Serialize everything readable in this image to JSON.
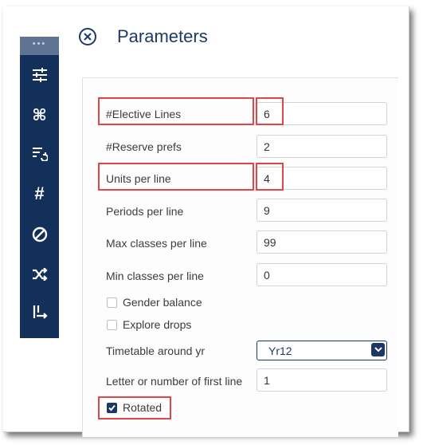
{
  "header": {
    "title": "Parameters",
    "close_icon": "close-circle-icon"
  },
  "sidebar": {
    "grip": "•••",
    "items": [
      {
        "icon": "sliders-icon"
      },
      {
        "icon": "command-icon"
      },
      {
        "icon": "list-refresh-icon"
      },
      {
        "icon": "hash-icon",
        "glyph": "#"
      },
      {
        "icon": "no-symbol-icon"
      },
      {
        "icon": "shuffle-icon"
      },
      {
        "icon": "sort-swap-icon"
      }
    ]
  },
  "form": {
    "elective_lines": {
      "label": "#Elective Lines",
      "value": "6"
    },
    "reserve_prefs": {
      "label": "#Reserve prefs",
      "value": "2"
    },
    "units_per_line": {
      "label": "Units per line",
      "value": "4"
    },
    "periods_per_line": {
      "label": "Periods per line",
      "value": "9"
    },
    "max_classes": {
      "label": "Max classes per line",
      "value": "99"
    },
    "min_classes": {
      "label": "Min classes per line",
      "value": "0"
    },
    "gender_balance": {
      "label": "Gender balance",
      "checked": false
    },
    "explore_drops": {
      "label": "Explore drops",
      "checked": false
    },
    "timetable_around": {
      "label": "Timetable around yr",
      "selected": "Yr12"
    },
    "first_line": {
      "label": "Letter or number of first line",
      "value": "1"
    },
    "rotated": {
      "label": "Rotated",
      "checked": true
    }
  },
  "colors": {
    "sidebar_bg": "#13305a",
    "accent": "#1b3764",
    "highlight": "#e0454a"
  }
}
